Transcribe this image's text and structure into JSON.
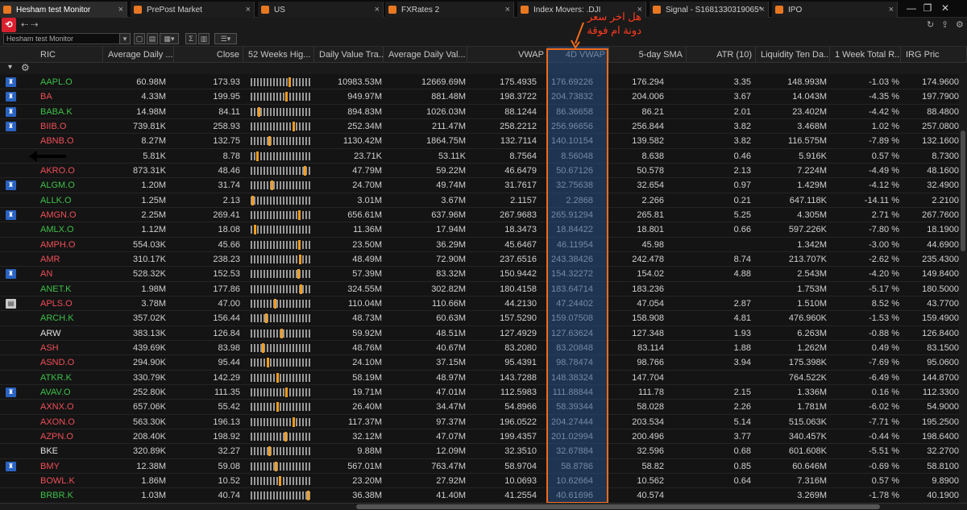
{
  "tabs": [
    {
      "label": "Hesham test Monitor",
      "active": true
    },
    {
      "label": "PrePost Market"
    },
    {
      "label": "US"
    },
    {
      "label": "FXRates 2"
    },
    {
      "label": "Index Movers: .DJI"
    },
    {
      "label": "Signal - S1681330319065*"
    },
    {
      "label": "IPO"
    }
  ],
  "toolbar": {
    "monitor_name": "Hesham test Monitor"
  },
  "annotation": "هل اخر سعر دونة ام فوقة",
  "columns": [
    "RIC",
    "Average Daily ...",
    "Close",
    "52 Weeks Hig...",
    "Daily Value Tra...",
    "Average Daily Val...",
    "VWAP",
    "4D VWAP",
    "5-day SMA",
    "ATR (10)",
    "Liquidity Ten Da...",
    "1 Week Total R...",
    "IRG Pric"
  ],
  "rows": [
    {
      "flag": "fin",
      "ric": "AAPL.O",
      "cls": "up",
      "adv": "60.98M",
      "close": "173.93",
      "m": 0.65,
      "dvt": "10983.53M",
      "adval": "12669.69M",
      "vwap": "175.4935",
      "v4": "176.69226",
      "sma": "176.294",
      "atr": "3.35",
      "liq": "148.993M",
      "wk": "-1.03 %",
      "irg": "174.9600"
    },
    {
      "flag": "fin",
      "ric": "BA",
      "cls": "dn",
      "adv": "4.33M",
      "close": "199.95",
      "m": 0.6,
      "dvt": "949.97M",
      "adval": "881.48M",
      "vwap": "198.3722",
      "v4": "204.73832",
      "sma": "204.006",
      "atr": "3.67",
      "liq": "14.043M",
      "wk": "-4.35 %",
      "irg": "197.7900"
    },
    {
      "flag": "fin",
      "ric": "BABA.K",
      "cls": "up",
      "adv": "14.98M",
      "close": "84.11",
      "m": 0.12,
      "dvt": "894.83M",
      "adval": "1026.03M",
      "vwap": "88.1244",
      "v4": "86.36658",
      "sma": "86.21",
      "atr": "2.01",
      "liq": "23.402M",
      "wk": "-4.42 %",
      "irg": "88.4800"
    },
    {
      "flag": "fin",
      "ric": "BIIB.O",
      "cls": "dn",
      "adv": "739.81K",
      "close": "258.93",
      "m": 0.72,
      "dvt": "252.34M",
      "adval": "211.47M",
      "vwap": "258.2212",
      "v4": "256.96656",
      "sma": "256.844",
      "atr": "3.82",
      "liq": "3.468M",
      "wk": "1.02 %",
      "irg": "257.0800"
    },
    {
      "flag": "",
      "ric": "ABNB.O",
      "cls": "dn",
      "adv": "8.27M",
      "close": "132.75",
      "m": 0.3,
      "dvt": "1130.42M",
      "adval": "1864.75M",
      "vwap": "132.7114",
      "v4": "140.10154",
      "sma": "139.582",
      "atr": "3.82",
      "liq": "116.575M",
      "wk": "-7.89 %",
      "irg": "132.1600"
    },
    {
      "flag": "",
      "ric": "",
      "cls": "nt",
      "adv": "5.81K",
      "close": "8.78",
      "m": 0.1,
      "dvt": "23.71K",
      "adval": "53.11K",
      "vwap": "8.7564",
      "v4": "8.56048",
      "sma": "8.638",
      "atr": "0.46",
      "liq": "5.916K",
      "wk": "0.57 %",
      "irg": "8.7300"
    },
    {
      "flag": "",
      "ric": "AKRO.O",
      "cls": "dn",
      "adv": "873.31K",
      "close": "48.46",
      "m": 0.92,
      "dvt": "47.79M",
      "adval": "59.22M",
      "vwap": "46.6479",
      "v4": "50.67126",
      "sma": "50.578",
      "atr": "2.13",
      "liq": "7.224M",
      "wk": "-4.49 %",
      "irg": "48.1600"
    },
    {
      "flag": "fin",
      "ric": "ALGM.O",
      "cls": "up",
      "adv": "1.20M",
      "close": "31.74",
      "m": 0.35,
      "dvt": "24.70M",
      "adval": "49.74M",
      "vwap": "31.7617",
      "v4": "32.75638",
      "sma": "32.654",
      "atr": "0.97",
      "liq": "1.429M",
      "wk": "-4.12 %",
      "irg": "32.4900"
    },
    {
      "flag": "",
      "ric": "ALLK.O",
      "cls": "up",
      "adv": "1.25M",
      "close": "2.13",
      "m": 0.02,
      "dvt": "3.01M",
      "adval": "3.67M",
      "vwap": "2.1157",
      "v4": "2.2868",
      "sma": "2.266",
      "atr": "0.21",
      "liq": "647.118K",
      "wk": "-14.11 %",
      "irg": "2.2100"
    },
    {
      "flag": "fin",
      "ric": "AMGN.O",
      "cls": "dn",
      "adv": "2.25M",
      "close": "269.41",
      "m": 0.82,
      "dvt": "656.61M",
      "adval": "637.96M",
      "vwap": "267.9683",
      "v4": "265.91294",
      "sma": "265.81",
      "atr": "5.25",
      "liq": "4.305M",
      "wk": "2.71 %",
      "irg": "267.7600"
    },
    {
      "flag": "",
      "ric": "AMLX.O",
      "cls": "up",
      "adv": "1.12M",
      "close": "18.08",
      "m": 0.05,
      "dvt": "11.36M",
      "adval": "17.94M",
      "vwap": "18.3473",
      "v4": "18.84422",
      "sma": "18.801",
      "atr": "0.66",
      "liq": "597.226K",
      "wk": "-7.80 %",
      "irg": "18.1900"
    },
    {
      "flag": "",
      "ric": "AMPH.O",
      "cls": "dn",
      "adv": "554.03K",
      "close": "45.66",
      "m": 0.82,
      "dvt": "23.50M",
      "adval": "36.29M",
      "vwap": "45.6467",
      "v4": "46.11954",
      "sma": "45.98",
      "atr": "",
      "liq": "1.342M",
      "wk": "-3.00 %",
      "irg": "44.6900"
    },
    {
      "flag": "",
      "ric": "AMR",
      "cls": "dn",
      "adv": "310.17K",
      "close": "238.23",
      "m": 0.83,
      "dvt": "48.49M",
      "adval": "72.90M",
      "vwap": "237.6516",
      "v4": "243.38426",
      "sma": "242.478",
      "atr": "8.74",
      "liq": "213.707K",
      "wk": "-2.62 %",
      "irg": "235.4300"
    },
    {
      "flag": "fin",
      "ric": "AN",
      "cls": "dn",
      "adv": "528.32K",
      "close": "152.53",
      "m": 0.8,
      "dvt": "57.39M",
      "adval": "83.32M",
      "vwap": "150.9442",
      "v4": "154.32272",
      "sma": "154.02",
      "atr": "4.88",
      "liq": "2.543M",
      "wk": "-4.20 %",
      "irg": "149.8400"
    },
    {
      "flag": "",
      "ric": "ANET.K",
      "cls": "up",
      "adv": "1.98M",
      "close": "177.86",
      "m": 0.85,
      "dvt": "324.55M",
      "adval": "302.82M",
      "vwap": "180.4158",
      "v4": "183.64714",
      "sma": "183.236",
      "atr": "",
      "liq": "1.753M",
      "wk": "-5.17 %",
      "irg": "180.5000"
    },
    {
      "flag": "doc",
      "ric": "APLS.O",
      "cls": "dn",
      "adv": "3.78M",
      "close": "47.00",
      "m": 0.4,
      "dvt": "110.04M",
      "adval": "110.66M",
      "vwap": "44.2130",
      "v4": "47.24402",
      "sma": "47.054",
      "atr": "2.87",
      "liq": "1.510M",
      "wk": "8.52 %",
      "irg": "43.7700"
    },
    {
      "flag": "",
      "ric": "ARCH.K",
      "cls": "up",
      "adv": "357.02K",
      "close": "156.44",
      "m": 0.25,
      "dvt": "48.73M",
      "adval": "60.63M",
      "vwap": "157.5290",
      "v4": "159.07508",
      "sma": "158.908",
      "atr": "4.81",
      "liq": "476.960K",
      "wk": "-1.53 %",
      "irg": "159.4900"
    },
    {
      "flag": "",
      "ric": "ARW",
      "cls": "nt",
      "adv": "383.13K",
      "close": "126.84",
      "m": 0.52,
      "dvt": "59.92M",
      "adval": "48.51M",
      "vwap": "127.4929",
      "v4": "127.63624",
      "sma": "127.348",
      "atr": "1.93",
      "liq": "6.263M",
      "wk": "-0.88 %",
      "irg": "126.8400"
    },
    {
      "flag": "",
      "ric": "ASH",
      "cls": "dn",
      "adv": "439.69K",
      "close": "83.98",
      "m": 0.2,
      "dvt": "48.76M",
      "adval": "40.67M",
      "vwap": "83.2080",
      "v4": "83.20848",
      "sma": "83.114",
      "atr": "1.88",
      "liq": "1.262M",
      "wk": "0.49 %",
      "irg": "83.1500"
    },
    {
      "flag": "",
      "ric": "ASND.O",
      "cls": "dn",
      "adv": "294.90K",
      "close": "95.44",
      "m": 0.28,
      "dvt": "24.10M",
      "adval": "37.15M",
      "vwap": "95.4391",
      "v4": "98.78474",
      "sma": "98.766",
      "atr": "3.94",
      "liq": "175.398K",
      "wk": "-7.69 %",
      "irg": "95.0600"
    },
    {
      "flag": "",
      "ric": "ATKR.K",
      "cls": "up",
      "adv": "330.79K",
      "close": "142.29",
      "m": 0.45,
      "dvt": "58.19M",
      "adval": "48.97M",
      "vwap": "143.7288",
      "v4": "148.38324",
      "sma": "147.704",
      "atr": "",
      "liq": "764.522K",
      "wk": "-6.49 %",
      "irg": "144.8700"
    },
    {
      "flag": "fin",
      "ric": "AVAV.O",
      "cls": "up",
      "adv": "252.80K",
      "close": "111.35",
      "m": 0.6,
      "dvt": "19.71M",
      "adval": "47.01M",
      "vwap": "112.5983",
      "v4": "111.88844",
      "sma": "111.78",
      "atr": "2.15",
      "liq": "1.336M",
      "wk": "0.16 %",
      "irg": "112.3300"
    },
    {
      "flag": "",
      "ric": "AXNX.O",
      "cls": "dn",
      "adv": "657.06K",
      "close": "55.42",
      "m": 0.45,
      "dvt": "26.40M",
      "adval": "34.47M",
      "vwap": "54.8966",
      "v4": "58.39344",
      "sma": "58.028",
      "atr": "2.26",
      "liq": "1.781M",
      "wk": "-6.02 %",
      "irg": "54.9000"
    },
    {
      "flag": "",
      "ric": "AXON.O",
      "cls": "dn",
      "adv": "563.30K",
      "close": "196.13",
      "m": 0.72,
      "dvt": "117.37M",
      "adval": "97.37M",
      "vwap": "196.0522",
      "v4": "204.27444",
      "sma": "203.534",
      "atr": "5.14",
      "liq": "515.063K",
      "wk": "-7.71 %",
      "irg": "195.2500"
    },
    {
      "flag": "",
      "ric": "AZPN.O",
      "cls": "dn",
      "adv": "208.40K",
      "close": "198.92",
      "m": 0.58,
      "dvt": "32.12M",
      "adval": "47.07M",
      "vwap": "199.4357",
      "v4": "201.02994",
      "sma": "200.496",
      "atr": "3.77",
      "liq": "340.457K",
      "wk": "-0.44 %",
      "irg": "198.6400"
    },
    {
      "flag": "",
      "ric": "BKE",
      "cls": "nt",
      "adv": "320.89K",
      "close": "32.27",
      "m": 0.3,
      "dvt": "9.88M",
      "adval": "12.09M",
      "vwap": "32.3510",
      "v4": "32.67884",
      "sma": "32.596",
      "atr": "0.68",
      "liq": "601.608K",
      "wk": "-5.51 %",
      "irg": "32.2700"
    },
    {
      "flag": "fin",
      "ric": "BMY",
      "cls": "dn",
      "adv": "12.38M",
      "close": "59.08",
      "m": 0.42,
      "dvt": "567.01M",
      "adval": "763.47M",
      "vwap": "58.9704",
      "v4": "58.8786",
      "sma": "58.82",
      "atr": "0.85",
      "liq": "60.646M",
      "wk": "-0.69 %",
      "irg": "58.8100"
    },
    {
      "flag": "",
      "ric": "BOWL.K",
      "cls": "dn",
      "adv": "1.86M",
      "close": "10.52",
      "m": 0.48,
      "dvt": "23.20M",
      "adval": "27.92M",
      "vwap": "10.0693",
      "v4": "10.62664",
      "sma": "10.562",
      "atr": "0.64",
      "liq": "7.316M",
      "wk": "0.57 %",
      "irg": "9.8900"
    },
    {
      "flag": "",
      "ric": "BRBR.K",
      "cls": "up",
      "adv": "1.03M",
      "close": "40.74",
      "m": 0.97,
      "dvt": "36.38M",
      "adval": "41.40M",
      "vwap": "41.2554",
      "v4": "40.61696",
      "sma": "40.574",
      "atr": "",
      "liq": "3.269M",
      "wk": "-1.78 %",
      "irg": "40.1900"
    }
  ]
}
